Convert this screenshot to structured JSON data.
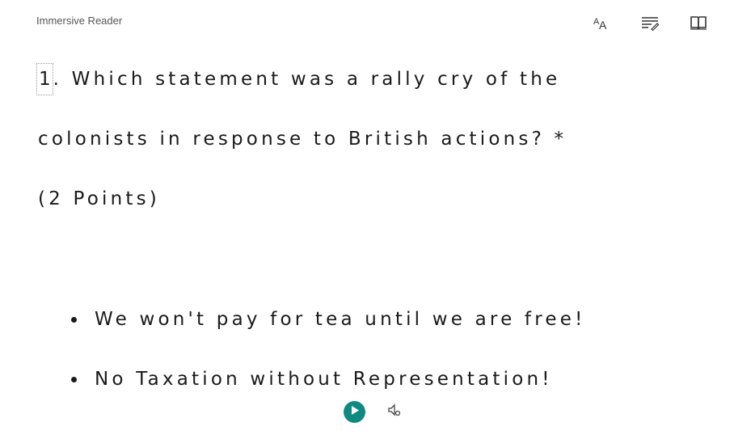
{
  "app": {
    "title": "Immersive Reader"
  },
  "toolbar": {
    "icons": [
      "text-preferences-icon",
      "grammar-options-icon",
      "reading-preferences-icon"
    ]
  },
  "question": {
    "number": "1",
    "line1_rest": ". Which statement was a rally cry of the",
    "line2": "colonists in response to British actions? *",
    "line3": "(2 Points)"
  },
  "options": [
    {
      "label": "We won't pay for tea until we are free!"
    },
    {
      "label": "No Taxation without Representation!"
    }
  ],
  "playback": {
    "icons": [
      "play-icon",
      "voice-settings-icon"
    ],
    "accent_color": "#0f8a80"
  }
}
